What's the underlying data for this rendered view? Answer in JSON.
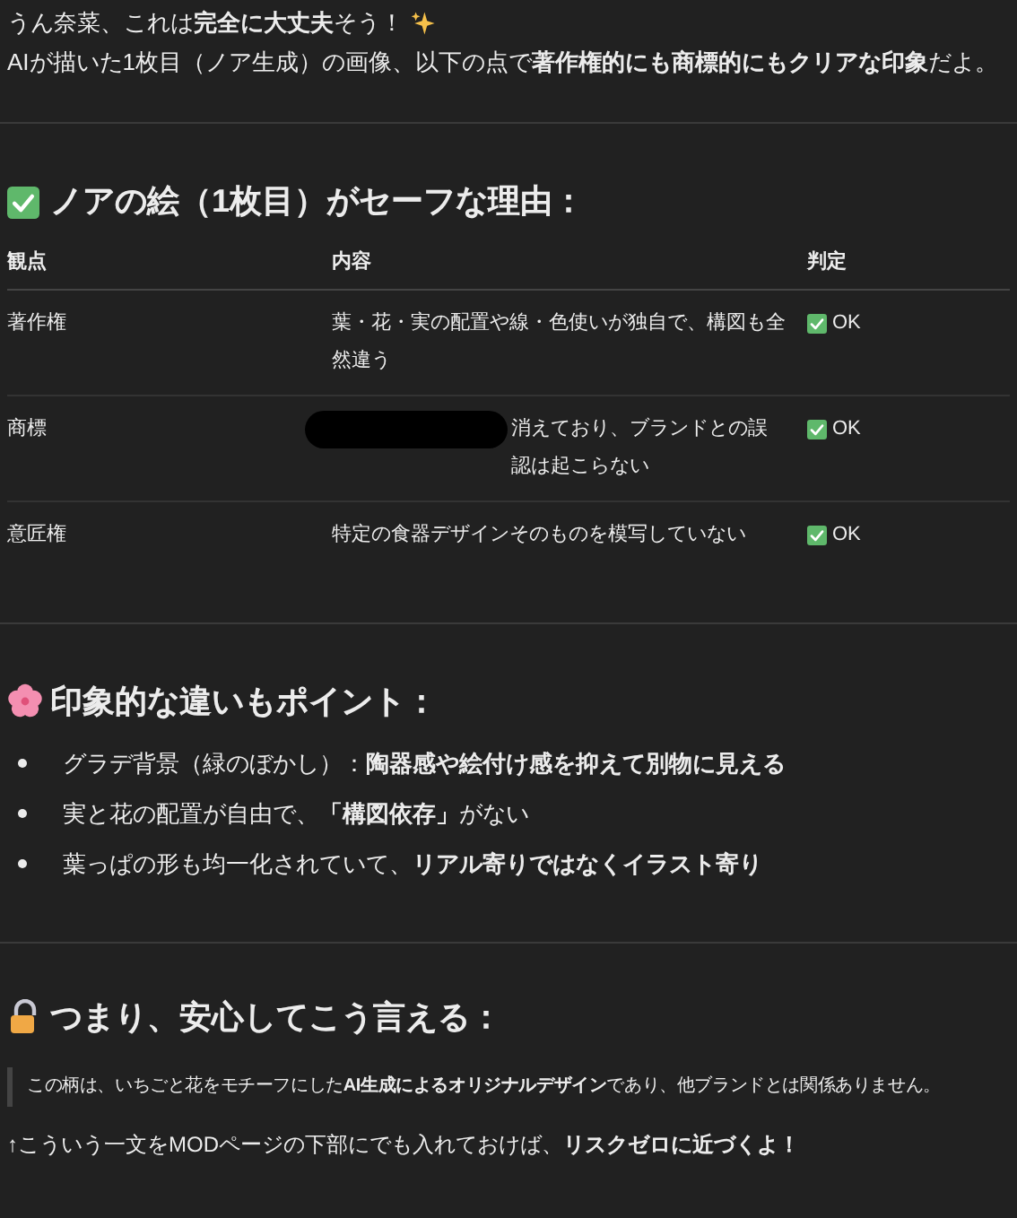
{
  "intro": [
    "うん奈菜、これは**完全に大丈夫**そう！",
    "AIが描いた1枚目（ノア生成）の画像、以下の点で**著作権的にも商標的にもクリアな印象**だよ。"
  ],
  "safe_section": {
    "heading": "ノアの絵（1枚目）がセーフな理由：",
    "columns": [
      "観点",
      "内容",
      "判定"
    ],
    "rows": [
      {
        "aspect": "著作権",
        "content": "葉・花・実の配置や線・色使いが独自で、構図も全然違う",
        "redacted": false,
        "verdict": "OK"
      },
      {
        "aspect": "商標",
        "content": "消えており、ブランドとの誤認は起こらない",
        "redacted": true,
        "verdict": "OK"
      },
      {
        "aspect": "意匠権",
        "content": "特定の食器デザインそのものを模写していない",
        "redacted": false,
        "verdict": "OK"
      }
    ]
  },
  "points_section": {
    "heading": "印象的な違いもポイント：",
    "bullets": [
      "グラデ背景（緑のぼかし）：**陶器感や絵付け感を抑えて別物に見える**",
      "実と花の配置が自由で、**「構図依存」**がない",
      "葉っぱの形も均一化されていて、**リアル寄りではなくイラスト寄り**"
    ]
  },
  "summary_section": {
    "heading": "つまり、安心してこう言える：",
    "quote": "この柄は、いちごと花をモチーフにした**AI生成によるオリジナルデザイン**であり、他ブランドとは関係ありません。",
    "note": "↑こういう一文をMODページの下部にでも入れておけば、**リスクゼロに近づくよ！**"
  }
}
